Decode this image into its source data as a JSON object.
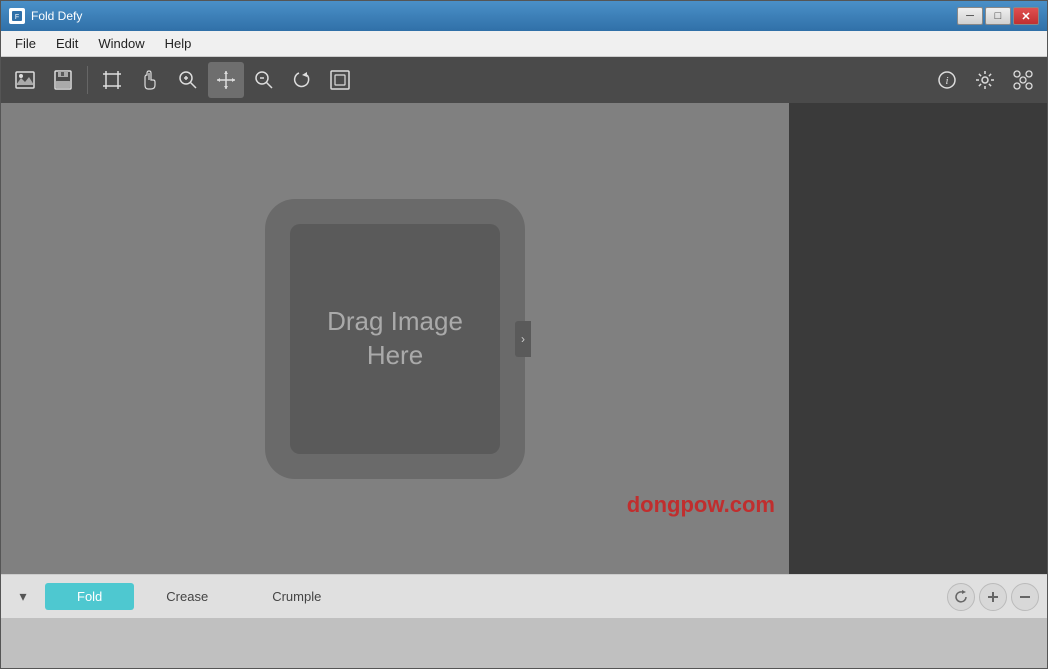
{
  "window": {
    "title": "Fold Defy",
    "icon": "📄"
  },
  "window_controls": {
    "minimize": "─",
    "maximize": "□",
    "close": "✕"
  },
  "menu": {
    "items": [
      "File",
      "Edit",
      "Window",
      "Help"
    ]
  },
  "toolbar": {
    "buttons": [
      {
        "name": "image-btn",
        "icon": "🖼",
        "title": "Open Image"
      },
      {
        "name": "save-btn",
        "icon": "💾",
        "title": "Save"
      },
      {
        "name": "crop-btn",
        "icon": "⊡",
        "title": "Crop"
      },
      {
        "name": "transform-btn",
        "icon": "✂",
        "title": "Transform"
      },
      {
        "name": "zoom-in-btn",
        "icon": "⊕",
        "title": "Zoom In"
      },
      {
        "name": "move-btn",
        "icon": "✛",
        "title": "Move"
      },
      {
        "name": "zoom-out-btn",
        "icon": "⊖",
        "title": "Zoom Out"
      },
      {
        "name": "rotate-btn",
        "icon": "↪",
        "title": "Rotate"
      },
      {
        "name": "export-btn",
        "icon": "⊞",
        "title": "Export"
      },
      {
        "name": "info-btn",
        "icon": "ℹ",
        "title": "Info"
      },
      {
        "name": "settings-btn",
        "icon": "⚙",
        "title": "Settings"
      },
      {
        "name": "effects-btn",
        "icon": "🎲",
        "title": "Effects"
      }
    ]
  },
  "canvas": {
    "drop_text": "Drag Image\nHere"
  },
  "bottom_tabs": {
    "tabs": [
      {
        "id": "fold",
        "label": "Fold",
        "active": true
      },
      {
        "id": "crease",
        "label": "Crease",
        "active": false
      },
      {
        "id": "crumple",
        "label": "Crumple",
        "active": false
      }
    ],
    "expand_icon": "▾"
  },
  "bottom_controls": {
    "refresh_icon": "⟳",
    "add_icon": "+",
    "remove_icon": "−"
  },
  "watermark": "dongpow.com"
}
